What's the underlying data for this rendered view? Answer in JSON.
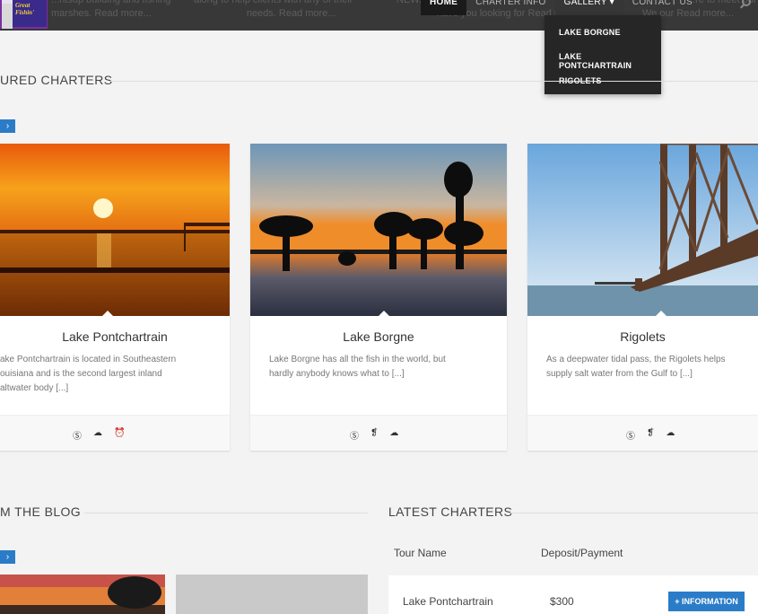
{
  "header": {
    "ghost_texts": [
      {
        "line1": "...ntsup building and fishing",
        "line2": "marshes.",
        "more": "Read more..."
      },
      {
        "line1": "along to help clients with any of their",
        "line2": "needs.",
        "more": "Read more..."
      },
      {
        "line1": "NEW...",
        "line2": "have you looking for",
        "more": "Read more..."
      },
      {
        "line1": "...re to meet our",
        "line2": "We our",
        "more": "Read more..."
      }
    ],
    "nav": {
      "home": "HOME",
      "charter_info": "CHARTER INFO",
      "gallery": "GALLERY ▾",
      "contact": "CONTACT US"
    },
    "gallery_menu": [
      "LAKE BORGNE",
      "LAKE PONTCHARTRAIN",
      "RIGOLETS"
    ],
    "logo_text": "Great Fishin'"
  },
  "featured": {
    "heading": "URED CHARTERS",
    "arrow": "›",
    "cards": [
      {
        "title": "Lake Pontchartrain",
        "desc_lines": [
          "ake Pontchartrain is located in Southeastern",
          "ouisiana and is the second largest inland",
          "altwater body [...]"
        ],
        "icons": [
          "dollar-icon",
          "cloud-icon",
          "alarm-icon"
        ]
      },
      {
        "title": "Lake Borgne",
        "desc_lines": [
          "Lake Borgne has all the fish in the world, but",
          "hardly anybody knows what to [...]"
        ],
        "icons": [
          "dollar-icon",
          "utensils-icon",
          "cloud-icon"
        ]
      },
      {
        "title": "Rigolets",
        "desc_lines": [
          "As a deepwater tidal pass, the Rigolets helps",
          "supply salt water from the Gulf to [...]"
        ],
        "icons": [
          "dollar-icon",
          "utensils-icon",
          "cloud-icon"
        ]
      }
    ],
    "glyphs": {
      "dollar-icon": "Ⓢ",
      "cloud-icon": "☁",
      "alarm-icon": "⏰",
      "utensils-icon": "❡"
    }
  },
  "blog": {
    "heading": "M THE BLOG",
    "arrow": "›"
  },
  "latest": {
    "heading": "LATEST CHARTERS",
    "col_tour": "Tour Name",
    "col_deposit": "Deposit/Payment",
    "rows": [
      {
        "name": "Lake Pontchartrain",
        "deposit": "$300",
        "button": "+ INFORMATION"
      }
    ]
  },
  "colors": {
    "accent": "#2b7cc8",
    "topbar": "#282828"
  }
}
